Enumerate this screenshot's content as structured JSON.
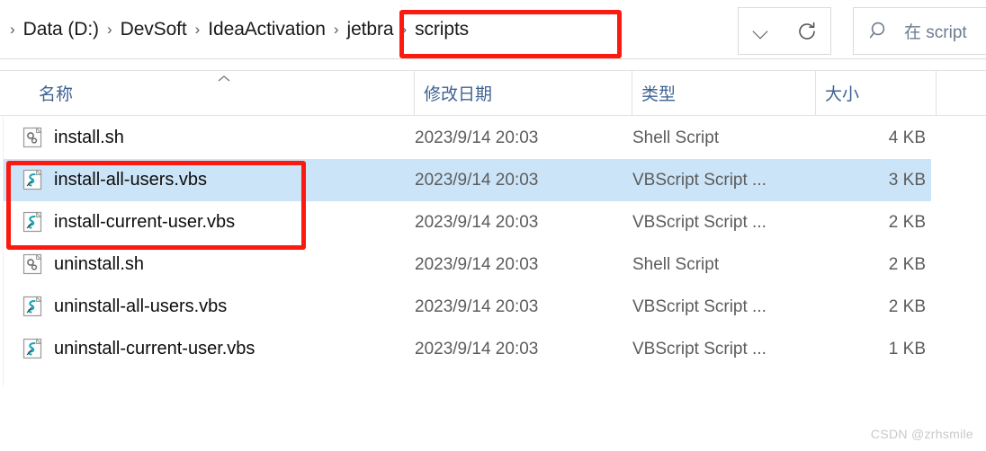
{
  "breadcrumb": {
    "leading_separator": "›",
    "separator": "›",
    "items": [
      {
        "label": "Data (D:)"
      },
      {
        "label": "DevSoft"
      },
      {
        "label": "IdeaActivation"
      },
      {
        "label": "jetbra"
      },
      {
        "label": "scripts"
      }
    ]
  },
  "toolbar": {
    "history_dropdown_icon": "chevron-down-icon",
    "refresh_icon": "refresh-icon"
  },
  "search": {
    "icon": "search-icon",
    "placeholder": "在 script"
  },
  "columns": [
    {
      "key": "name",
      "label": "名称",
      "sorted": "asc"
    },
    {
      "key": "date",
      "label": "修改日期"
    },
    {
      "key": "type",
      "label": "类型"
    },
    {
      "key": "size",
      "label": "大小"
    }
  ],
  "files": [
    {
      "name": "install.sh",
      "date": "2023/9/14 20:03",
      "type": "Shell Script",
      "size": "4 KB",
      "icon": "shell-script-file-icon",
      "selected": false
    },
    {
      "name": "install-all-users.vbs",
      "date": "2023/9/14 20:03",
      "type": "VBScript Script ...",
      "size": "3 KB",
      "icon": "vbscript-file-icon",
      "selected": true
    },
    {
      "name": "install-current-user.vbs",
      "date": "2023/9/14 20:03",
      "type": "VBScript Script ...",
      "size": "2 KB",
      "icon": "vbscript-file-icon",
      "selected": false
    },
    {
      "name": "uninstall.sh",
      "date": "2023/9/14 20:03",
      "type": "Shell Script",
      "size": "2 KB",
      "icon": "shell-script-file-icon",
      "selected": false
    },
    {
      "name": "uninstall-all-users.vbs",
      "date": "2023/9/14 20:03",
      "type": "VBScript Script ...",
      "size": "2 KB",
      "icon": "vbscript-file-icon",
      "selected": false
    },
    {
      "name": "uninstall-current-user.vbs",
      "date": "2023/9/14 20:03",
      "type": "VBScript Script ...",
      "size": "1 KB",
      "icon": "vbscript-file-icon",
      "selected": false
    }
  ],
  "annotations": [
    {
      "name": "path-highlight",
      "target": "jetbra › scripts",
      "color": "#fc1a10"
    },
    {
      "name": "files-highlight",
      "target": "install-all-users.vbs / install-current-user.vbs",
      "color": "#fc1a10"
    }
  ],
  "watermark": {
    "text": "CSDN @zrhsmile"
  },
  "colors": {
    "selection": "#cce4f7",
    "header_text": "#3f6292",
    "annotation": "#fc1a10"
  }
}
